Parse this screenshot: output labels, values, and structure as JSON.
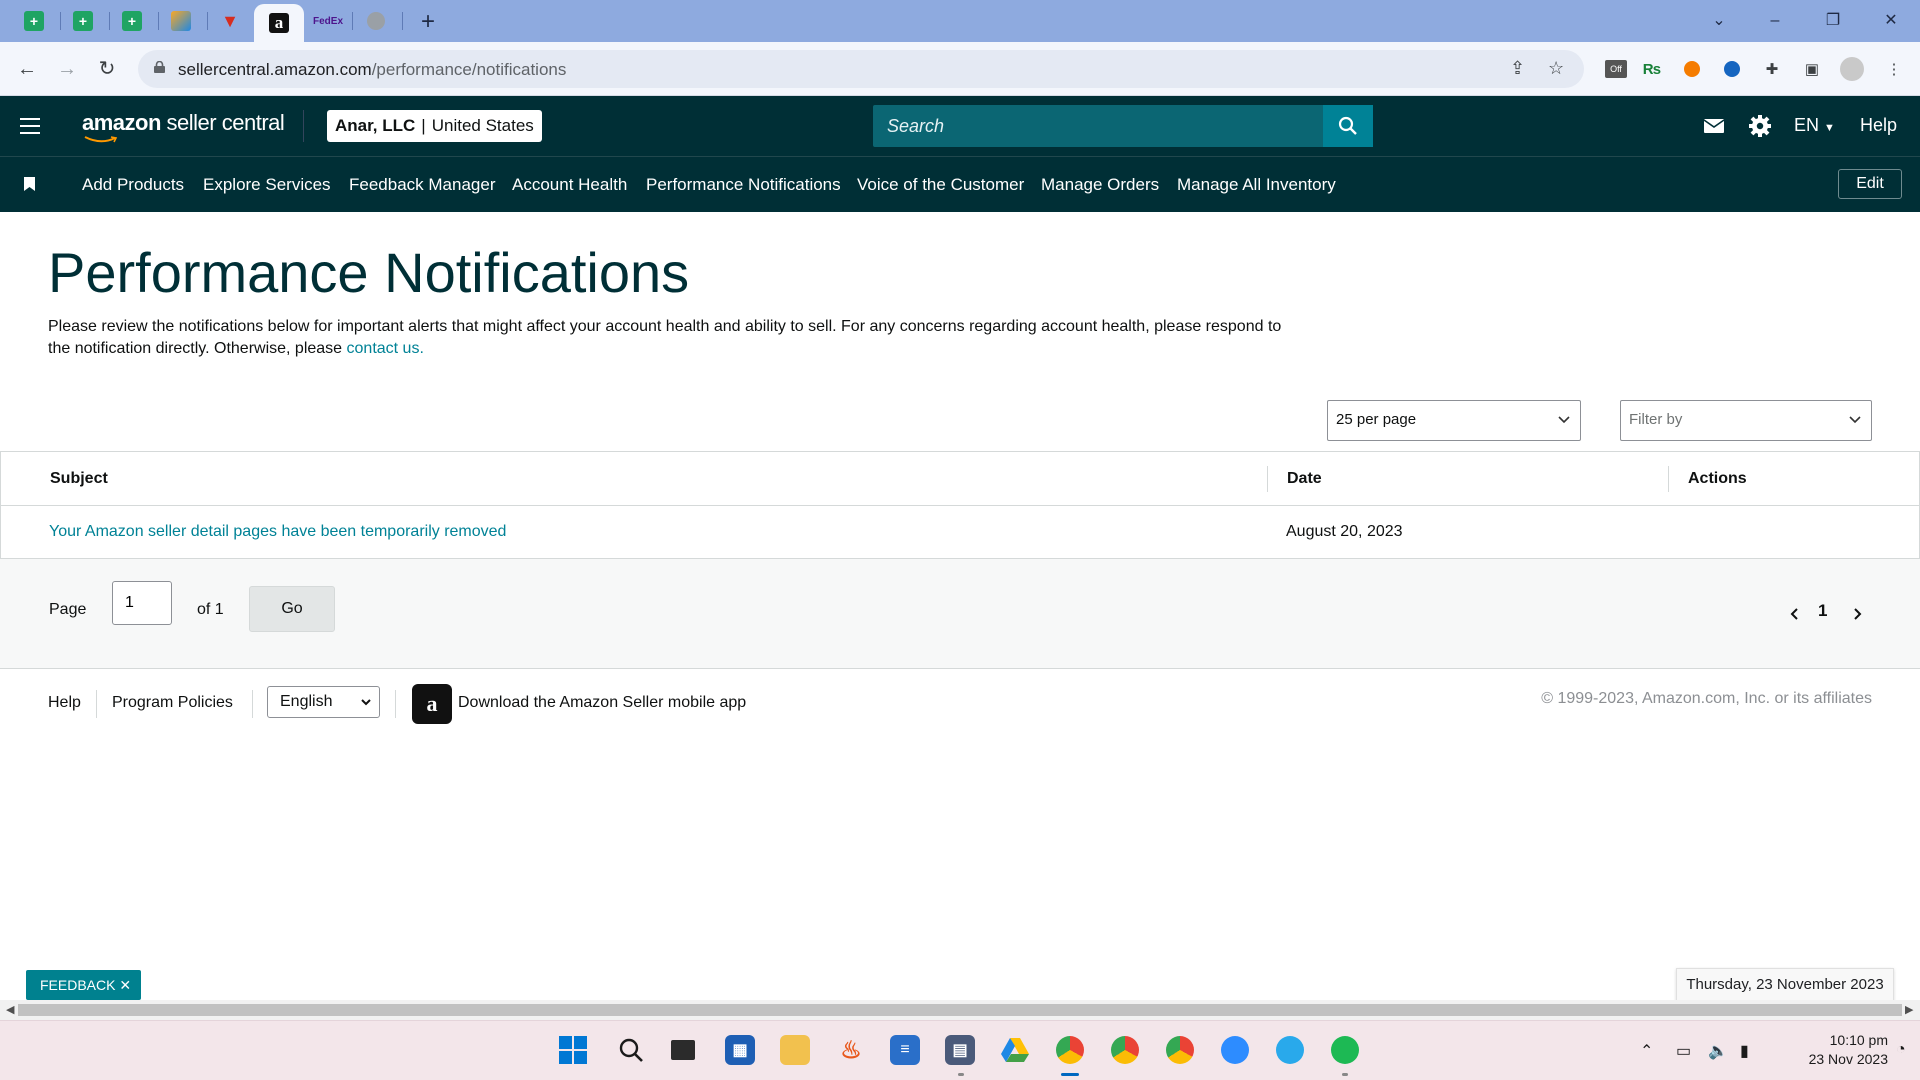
{
  "browser": {
    "tabs": [
      {
        "icon": "sheets-icon",
        "active": false
      },
      {
        "icon": "sheets-icon",
        "active": false
      },
      {
        "icon": "sheets-icon",
        "active": false
      },
      {
        "icon": "app-icon",
        "active": false
      },
      {
        "icon": "vivaldi-icon",
        "active": false
      },
      {
        "icon": "amazon-icon",
        "active": true
      },
      {
        "icon": "fedex-icon",
        "active": false
      },
      {
        "icon": "globe-icon",
        "active": false
      }
    ],
    "url_host": "sellercentral.amazon.com",
    "url_path": "/performance/notifications",
    "ext_badge": "Off"
  },
  "header": {
    "logo_brand": "amazon",
    "logo_product": "seller central",
    "account_name": "Anar, LLC",
    "account_sep": "|",
    "account_region": "United States",
    "search_placeholder": "Search",
    "language": "EN",
    "help": "Help"
  },
  "nav": {
    "items": [
      "Add Products",
      "Explore Services",
      "Feedback Manager",
      "Account Health",
      "Performance Notifications",
      "Voice of the Customer",
      "Manage Orders",
      "Manage All Inventory"
    ],
    "edit": "Edit"
  },
  "page": {
    "title": "Performance Notifications",
    "intro": "Please review the notifications below for important alerts that might affect your account health and ability to sell. For any concerns regarding account health, please respond to the notification directly. Otherwise, please ",
    "contact_link": "contact us."
  },
  "controls": {
    "per_page": "25 per page",
    "filter_placeholder": "Filter by"
  },
  "table": {
    "headers": [
      "Subject",
      "Date",
      "Actions"
    ],
    "rows": [
      {
        "subject": "Your Amazon seller detail pages have been temporarily removed",
        "date": "August 20, 2023",
        "actions": ""
      }
    ]
  },
  "pagination": {
    "page_label": "Page",
    "current": "1",
    "of_label": "of 1",
    "go": "Go",
    "page_number": "1"
  },
  "footer": {
    "help": "Help",
    "policies": "Program Policies",
    "language": "English",
    "app_text": "Download the Amazon Seller mobile app",
    "copyright": "© 1999-2023, Amazon.com, Inc. or its affiliates"
  },
  "feedback": {
    "label": "FEEDBACK",
    "close": "✕"
  },
  "tooltip": {
    "date": "Thursday, 23 November 2023"
  },
  "taskbar": {
    "apps": [
      "windows-start-icon",
      "search-icon",
      "task-view-icon",
      "store-icon",
      "file-explorer-icon",
      "firefox-icon",
      "notepad-icon",
      "calculator-icon",
      "google-drive-icon",
      "chrome-icon",
      "chrome-icon",
      "chrome-icon",
      "zoom-icon",
      "telegram-icon",
      "spotify-icon"
    ],
    "time": "10:10 pm",
    "date": "23 Nov 2023"
  },
  "colors": {
    "header_bg": "#002f36",
    "accent": "#008296",
    "link": "#008296",
    "title": "#002f36"
  }
}
